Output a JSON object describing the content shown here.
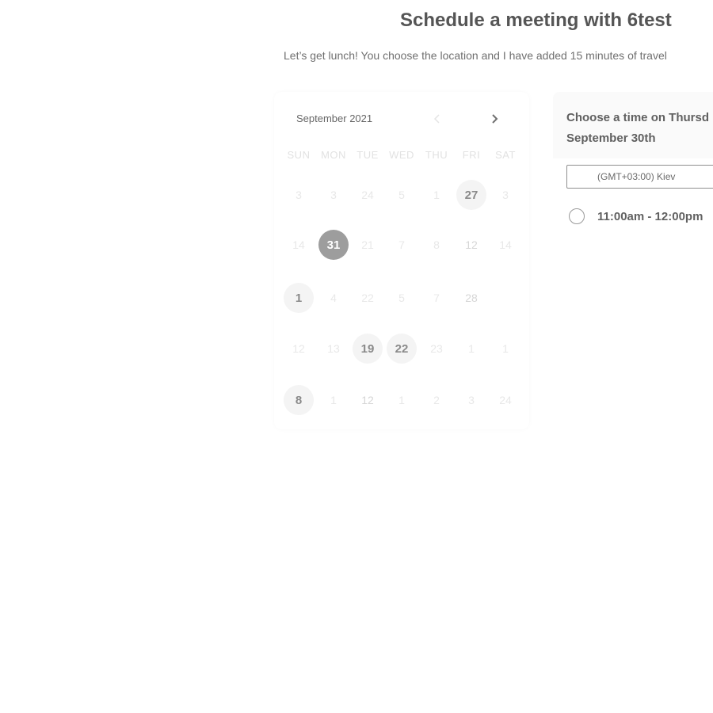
{
  "header": {
    "title": "Schedule a meeting with 6test",
    "subtitle": "Let’s get lunch! You choose the location and I have added 15 minutes of travel"
  },
  "calendar": {
    "month_label": "September 2021",
    "prev_icon": "chevron-left-icon",
    "next_icon": "chevron-right-icon",
    "weekdays": [
      "SUN",
      "MON",
      "TUE",
      "WED",
      "THU",
      "FRI",
      "SAT"
    ],
    "rows": [
      [
        "3",
        "3",
        "24",
        "5",
        "1",
        "27",
        "3"
      ],
      [
        "14",
        "31",
        "21",
        "7",
        "8",
        "12",
        "14"
      ],
      [
        "1",
        "4",
        "22",
        "5",
        "7",
        "28",
        ""
      ],
      [
        "12",
        "13",
        "19",
        "22",
        "23",
        "1",
        "1"
      ],
      [
        "8",
        "1",
        "12",
        "1",
        "2",
        "3",
        "24"
      ]
    ],
    "available_days": [
      "27",
      "1",
      "19",
      "22",
      "8"
    ],
    "selected_day": "31"
  },
  "time_panel": {
    "heading_line1": "Choose a time on Thursd",
    "heading_line2": "September 30th",
    "timezone": "(GMT+03:00) Kiev",
    "slots": [
      {
        "label": "11:00am - 12:00pm"
      }
    ]
  },
  "colors": {
    "selected_day_bg": "#9d9d9d",
    "available_day_bg": "#f4f4f4",
    "text": "#555555"
  }
}
